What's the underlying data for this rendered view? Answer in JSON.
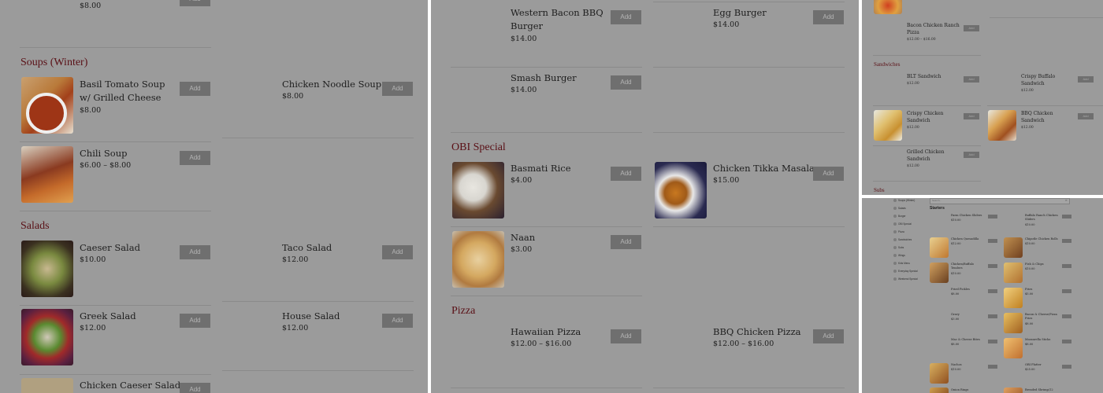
{
  "panel1": {
    "top_price": "$8.00",
    "sections": [
      {
        "title": "Soups (Winter)"
      },
      {
        "title": "Salads"
      }
    ],
    "items": [
      {
        "name": "Basil Tomato Soup w/ Grilled Cheese",
        "price": "$8.00"
      },
      {
        "name": "Chicken Noodle Soup",
        "price": "$8.00"
      },
      {
        "name": "Chili Soup",
        "price": "$6.00 – $8.00"
      },
      {
        "name": "Caeser Salad",
        "price": "$10.00"
      },
      {
        "name": "Taco Salad",
        "price": "$12.00"
      },
      {
        "name": "Greek Salad",
        "price": "$12.00"
      },
      {
        "name": "House Salad",
        "price": "$12.00"
      },
      {
        "name": "Chicken Caeser Salad",
        "price": ""
      }
    ]
  },
  "panel2": {
    "sections": [
      {
        "title": "OBI Special"
      },
      {
        "title": "Pizza"
      }
    ],
    "items": [
      {
        "name": "Western Bacon BBQ Burger",
        "price": "$14.00"
      },
      {
        "name": "Egg Burger",
        "price": "$14.00"
      },
      {
        "name": "Smash Burger",
        "price": "$14.00"
      },
      {
        "name": "Basmati Rice",
        "price": "$4.00"
      },
      {
        "name": "Chicken Tikka Masala",
        "price": "$15.00"
      },
      {
        "name": "Naan",
        "price": "$3.00"
      },
      {
        "name": "Hawaiian Pizza",
        "price": "$12.00 – $16.00"
      },
      {
        "name": "BBQ Chicken Pizza",
        "price": "$12.00 – $16.00"
      }
    ]
  },
  "panel3": {
    "sections": [
      {
        "title": "Sandwiches"
      },
      {
        "title": "Subs"
      }
    ],
    "items": [
      {
        "name": "Bacon Chicken Ranch Pizza",
        "price": "$12.00 – $16.00"
      },
      {
        "name": "BLT Sandwich",
        "price": "$12.00"
      },
      {
        "name": "Crispy Buffalo Sandwich",
        "price": "$12.00"
      },
      {
        "name": "Crispy Chicken Sandwich",
        "price": "$12.00"
      },
      {
        "name": "BBQ Chicken Sandwich",
        "price": "$12.00"
      },
      {
        "name": "Grilled Chicken Sandwich",
        "price": "$12.00"
      }
    ]
  },
  "panel4": {
    "search_placeholder": "Search...",
    "section_title": "Starters",
    "nav": [
      "Soups (Winter)",
      "Salads",
      "Burger",
      "OBI Special",
      "Pizza",
      "Sandwiches",
      "Subs",
      "Wings",
      "Kids Menu",
      "Everyday Special",
      "Weekend Special"
    ],
    "items": [
      {
        "name": "Parm Chicken Sliders",
        "price": "$10.00"
      },
      {
        "name": "Buffalo Ranch Chicken Sliders",
        "price": "$10.00"
      },
      {
        "name": "Chicken Quesadilla",
        "price": "$12.00"
      },
      {
        "name": "Chipotle Chicken Rolls",
        "price": "$10.00"
      },
      {
        "name": "Chicken/Buffalo Tenders",
        "price": "$10.00"
      },
      {
        "name": "Fish & Chips",
        "price": "$10.00"
      },
      {
        "name": "Fried Pickles",
        "price": "$8.00"
      },
      {
        "name": "Fries",
        "price": "$5.00"
      },
      {
        "name": "Gravy",
        "price": "$3.00"
      },
      {
        "name": "Bacon & Cheese/Pizza Fries",
        "price": "$8.00"
      },
      {
        "name": "Mac & Cheese Bites",
        "price": "$8.00"
      },
      {
        "name": "Mozzarella Sticks",
        "price": "$8.00"
      },
      {
        "name": "Nachos",
        "price": "$10.00"
      },
      {
        "name": "OBI Platter",
        "price": "$25.00"
      },
      {
        "name": "Onion Rings",
        "price": ""
      },
      {
        "name": "Breaded Shrimp/12",
        "price": ""
      }
    ]
  },
  "add_label": "Add",
  "colors": {
    "overlay": "#9b9b9b",
    "section": "#5a1016",
    "button": "#6f6f6f"
  }
}
